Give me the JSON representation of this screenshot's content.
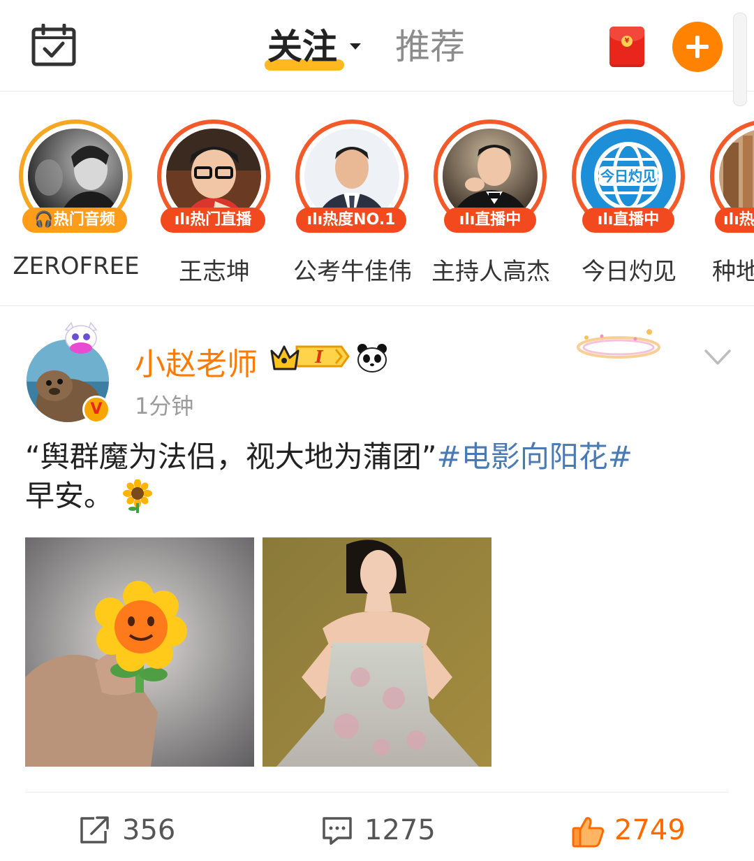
{
  "header": {
    "tabs": [
      {
        "label": "关注",
        "active": true
      },
      {
        "label": "推荐",
        "active": false
      }
    ],
    "icons": [
      "calendar-check-icon",
      "red-packet-icon",
      "plus-icon"
    ],
    "accent_color": "#ff8200"
  },
  "stories": [
    {
      "name": "ZEROFREE",
      "tag": "🎧热门音频",
      "ring": "#f5a623"
    },
    {
      "name": "王志坤",
      "tag": "ılı热门直播",
      "ring": "#f25a2a"
    },
    {
      "name": "公考牛佳伟",
      "tag": "ılı热度NO.1",
      "ring": "#f25a2a"
    },
    {
      "name": "主持人高杰",
      "tag": "ılı直播中",
      "ring": "#f25a2a"
    },
    {
      "name": "今日灼见",
      "tag": "ılı直播中",
      "ring": "#f25a2a"
    },
    {
      "name": "种地",
      "tag": "ılı热",
      "ring": "#f25a2a"
    }
  ],
  "post": {
    "username": "小赵老师",
    "username_color": "#ff7a00",
    "level_badge": "I",
    "time": "1分钟",
    "text_quote": "“舆群魔为法侣，视大地为蒲团”",
    "hashtag": "#电影向阳花#",
    "text_tail": "早安。",
    "stats": {
      "reposts": "356",
      "comments": "1275",
      "likes": "2749"
    }
  },
  "avatar_labels": {
    "news_logo": "今日灼见"
  }
}
